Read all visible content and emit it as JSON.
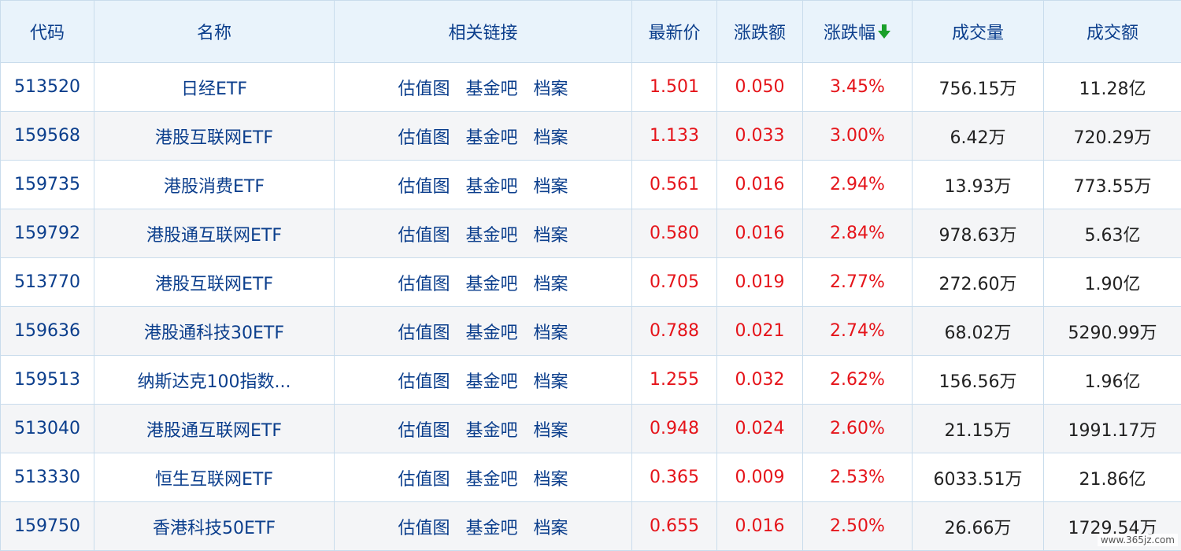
{
  "headers": {
    "code": "代码",
    "name": "名称",
    "links": "相关链接",
    "price": "最新价",
    "change": "涨跌额",
    "pct": "涨跌幅",
    "volume": "成交量",
    "amount": "成交额"
  },
  "link_labels": [
    "估值图",
    "基金吧",
    "档案"
  ],
  "sort": {
    "column": "pct",
    "direction": "desc",
    "icon": "arrow-down-icon",
    "color": "#1aa02a"
  },
  "colors": {
    "header_text": "#0b3e8c",
    "up": "#e5141a",
    "header_bg": "#e9f3fb"
  },
  "rows": [
    {
      "code": "513520",
      "name": "日经ETF",
      "price": "1.501",
      "change": "0.050",
      "pct": "3.45%",
      "volume": "756.15万",
      "amount": "11.28亿"
    },
    {
      "code": "159568",
      "name": "港股互联网ETF",
      "price": "1.133",
      "change": "0.033",
      "pct": "3.00%",
      "volume": "6.42万",
      "amount": "720.29万"
    },
    {
      "code": "159735",
      "name": "港股消费ETF",
      "price": "0.561",
      "change": "0.016",
      "pct": "2.94%",
      "volume": "13.93万",
      "amount": "773.55万"
    },
    {
      "code": "159792",
      "name": "港股通互联网ETF",
      "price": "0.580",
      "change": "0.016",
      "pct": "2.84%",
      "volume": "978.63万",
      "amount": "5.63亿"
    },
    {
      "code": "513770",
      "name": "港股互联网ETF",
      "price": "0.705",
      "change": "0.019",
      "pct": "2.77%",
      "volume": "272.60万",
      "amount": "1.90亿"
    },
    {
      "code": "159636",
      "name": "港股通科技30ETF",
      "price": "0.788",
      "change": "0.021",
      "pct": "2.74%",
      "volume": "68.02万",
      "amount": "5290.99万"
    },
    {
      "code": "159513",
      "name": "纳斯达克100指数...",
      "price": "1.255",
      "change": "0.032",
      "pct": "2.62%",
      "volume": "156.56万",
      "amount": "1.96亿"
    },
    {
      "code": "513040",
      "name": "港股通互联网ETF",
      "price": "0.948",
      "change": "0.024",
      "pct": "2.60%",
      "volume": "21.15万",
      "amount": "1991.17万"
    },
    {
      "code": "513330",
      "name": "恒生互联网ETF",
      "price": "0.365",
      "change": "0.009",
      "pct": "2.53%",
      "volume": "6033.51万",
      "amount": "21.86亿"
    },
    {
      "code": "159750",
      "name": "香港科技50ETF",
      "price": "0.655",
      "change": "0.016",
      "pct": "2.50%",
      "volume": "26.66万",
      "amount": "1729.54万"
    }
  ],
  "watermark": "www.365jz.com"
}
